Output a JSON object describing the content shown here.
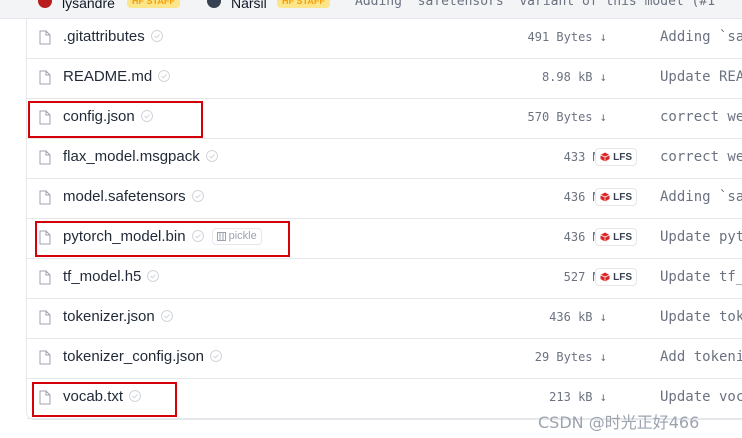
{
  "header": {
    "user1": "lysandre",
    "user1_tag": "HF STAFF",
    "user2": "Narsil",
    "user2_tag": "HF STAFF",
    "commit_message": "Adding `safetensors` variant of this model (#1"
  },
  "files": [
    {
      "name": ".gitattributes",
      "size": "491 Bytes",
      "lfs": false,
      "pickle": false,
      "commit": "Adding `sa"
    },
    {
      "name": "README.md",
      "size": "8.98 kB",
      "lfs": false,
      "pickle": false,
      "commit": "Update REA"
    },
    {
      "name": "config.json",
      "size": "570 Bytes",
      "lfs": false,
      "pickle": false,
      "commit": "correct we"
    },
    {
      "name": "flax_model.msgpack",
      "size": "433 MB",
      "lfs": true,
      "pickle": false,
      "commit": "correct we"
    },
    {
      "name": "model.safetensors",
      "size": "436 MB",
      "lfs": true,
      "pickle": false,
      "commit": "Adding `sa"
    },
    {
      "name": "pytorch_model.bin",
      "size": "436 MB",
      "lfs": true,
      "pickle": true,
      "pickle_label": "pickle",
      "commit": "Update pyt"
    },
    {
      "name": "tf_model.h5",
      "size": "527 MB",
      "lfs": true,
      "pickle": false,
      "commit": "Update tf_"
    },
    {
      "name": "tokenizer.json",
      "size": "436 kB",
      "lfs": false,
      "pickle": false,
      "commit": "Update tok"
    },
    {
      "name": "tokenizer_config.json",
      "size": "29 Bytes",
      "lfs": false,
      "pickle": false,
      "commit": "Add tokeni"
    },
    {
      "name": "vocab.txt",
      "size": "213 kB",
      "lfs": false,
      "pickle": false,
      "commit": "Update voc"
    }
  ],
  "lfs_label": "LFS",
  "highlight_color": "#d4000a",
  "watermark": "CSDN @时光正好466"
}
